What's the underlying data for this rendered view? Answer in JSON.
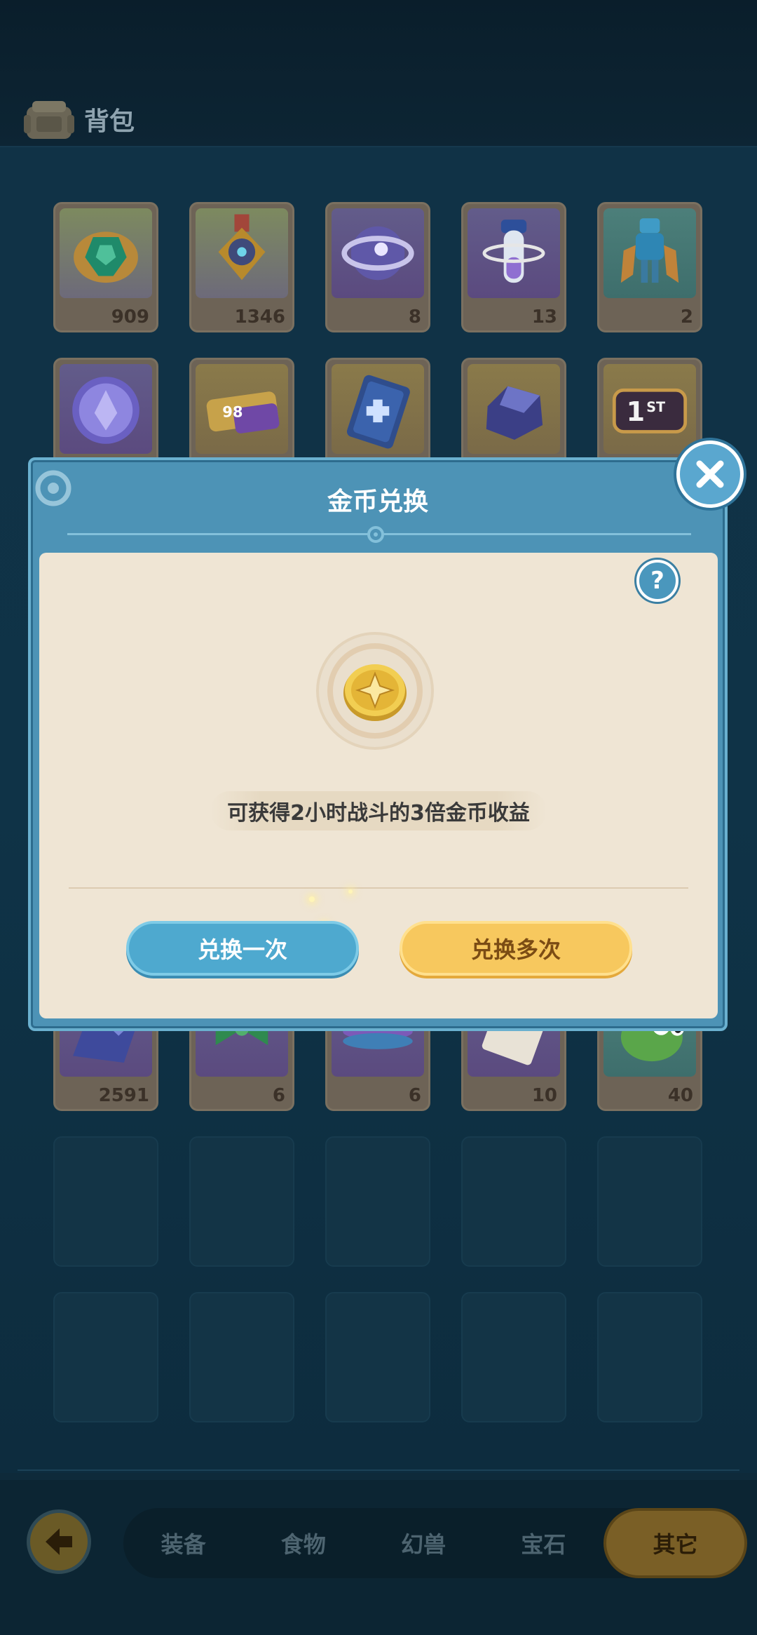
{
  "header": {
    "title": "背包",
    "icon": "backpack-icon"
  },
  "inventory": {
    "row1": [
      {
        "icon": "green-gem-ring-icon",
        "count": "909"
      },
      {
        "icon": "star-medal-icon",
        "count": "1346"
      },
      {
        "icon": "purple-swirl-orb-icon",
        "count": "8"
      },
      {
        "icon": "potion-vial-icon",
        "count": "13"
      },
      {
        "icon": "mech-figure-icon",
        "count": "2"
      }
    ],
    "row2": [
      {
        "icon": "crystal-coin-icon"
      },
      {
        "icon": "ticket-98-icon"
      },
      {
        "icon": "card-pack-icon"
      },
      {
        "icon": "dark-crystal-icon"
      },
      {
        "icon": "first-place-badge-icon"
      }
    ],
    "row5": [
      {
        "icon": "blue-crystal-icon",
        "count": "2591"
      },
      {
        "icon": "green-bow-icon",
        "count": "6"
      },
      {
        "icon": "stacked-rings-icon",
        "count": "6"
      },
      {
        "icon": "paper-scroll-icon",
        "count": "10"
      },
      {
        "icon": "green-creature-icon",
        "count": "40"
      }
    ]
  },
  "dialog": {
    "title": "金币兑换",
    "help_label": "?",
    "description": "可获得2小时战斗的3倍金币收益",
    "exchange_once_label": "兑换一次",
    "exchange_multi_label": "兑换多次",
    "close_icon": "close-icon",
    "coin_icon": "gold-coin-icon"
  },
  "tabs": [
    {
      "label": "装备"
    },
    {
      "label": "食物"
    },
    {
      "label": "幻兽"
    },
    {
      "label": "宝石"
    },
    {
      "label": "其它",
      "active": true
    }
  ],
  "colors": {
    "dialog_blue": "#4d93b6",
    "card_cream": "#efe5d4",
    "button_blue": "#4ea9cf",
    "button_gold": "#f7c85e",
    "background_navy": "#0e2a3a"
  }
}
